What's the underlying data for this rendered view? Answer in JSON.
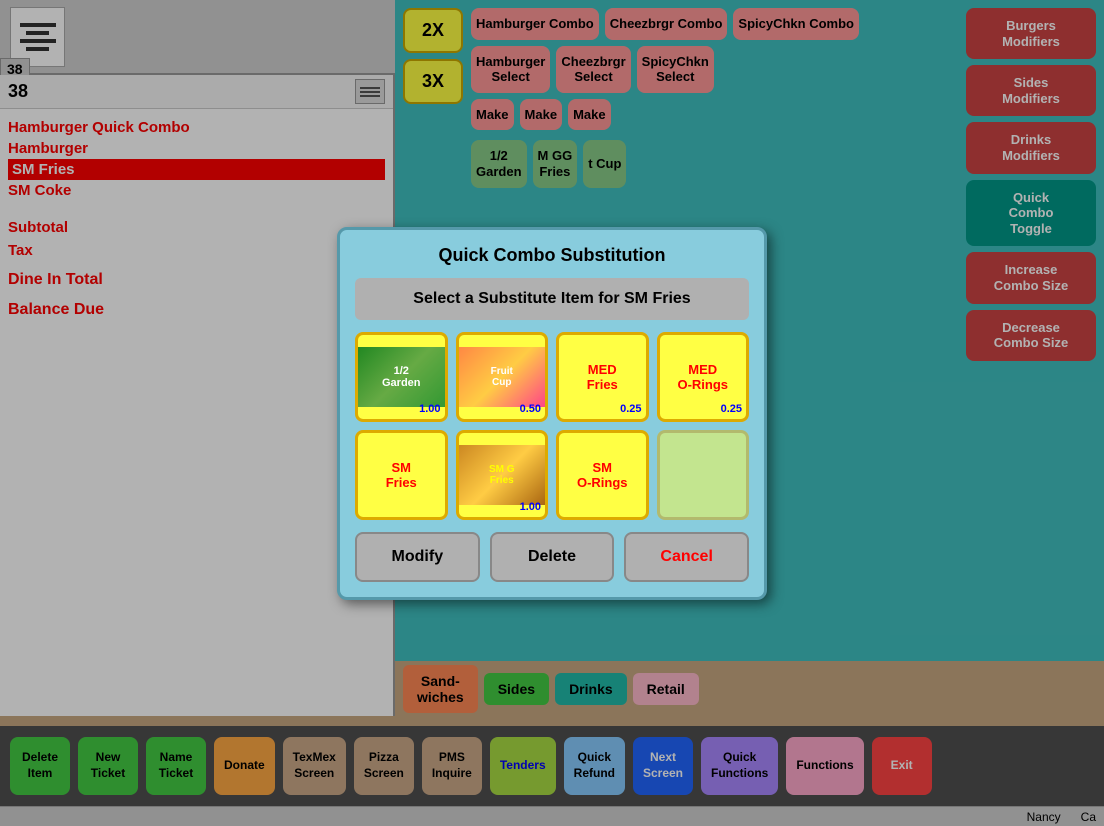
{
  "topBar": {
    "ticketNumber": "38"
  },
  "orderArea": {
    "ticketLabel": "38",
    "items": [
      {
        "text": "Hamburger Quick Combo",
        "selected": false
      },
      {
        "text": "Hamburger",
        "selected": false
      },
      {
        "text": "SM Fries",
        "selected": true
      },
      {
        "text": "SM Coke",
        "selected": false
      }
    ],
    "subtotalLabel": "Subtotal",
    "taxLabel": "Tax",
    "dineInLabel": "Dine In Total",
    "balanceLabel": "Balance Due"
  },
  "menuButtons": {
    "row1": [
      {
        "label": "Hamburger\nCombo",
        "color": "pink"
      },
      {
        "label": "Cheezbrgr\nCombo",
        "color": "pink"
      },
      {
        "label": "SpicyChkn\nCombo",
        "color": "pink"
      }
    ],
    "row2": [
      {
        "label": "Hamburger\nSelect",
        "color": "pink"
      },
      {
        "label": "Cheezbrgr\nSelect",
        "color": "pink"
      },
      {
        "label": "SpicyChkn\nSelect",
        "color": "pink"
      }
    ],
    "row3": [
      {
        "label": "Make\n...",
        "color": "pink"
      },
      {
        "label": "Make\n...",
        "color": "pink"
      },
      {
        "label": "Make\n...",
        "color": "pink"
      }
    ],
    "multipliers": [
      "2X",
      "3X"
    ],
    "modifiers": [
      {
        "label": "Burgers\nModifiers",
        "color": "mod"
      },
      {
        "label": "Sides\nModifiers",
        "color": "mod"
      },
      {
        "label": "Drinks\nModifiers",
        "color": "mod"
      },
      {
        "label": "Quick\nCombo\nToggle",
        "color": "mod"
      }
    ],
    "rightSide": [
      {
        "label": "Increase\nCombo Size",
        "color": "mod"
      },
      {
        "label": "Decrease\nCombo Size",
        "color": "mod"
      }
    ],
    "midItems": [
      {
        "label": "1/2\nGarden",
        "color": "green-item"
      },
      {
        "label": "M GG\nFries",
        "color": "green-item"
      },
      {
        "label": "t Cup",
        "color": "green-item"
      }
    ]
  },
  "categoryBar": {
    "items": [
      {
        "label": "Sand-\nwiches",
        "color": "salmon-dark"
      },
      {
        "label": "Sides",
        "color": "green"
      },
      {
        "label": "Drinks",
        "color": "teal"
      },
      {
        "label": "Retail",
        "color": "pink-light"
      }
    ]
  },
  "actionBar": {
    "buttons": [
      {
        "label": "Delete\nItem",
        "color": "green"
      },
      {
        "label": "New\nTicket",
        "color": "green"
      },
      {
        "label": "Name\nTicket",
        "color": "green"
      },
      {
        "label": "Donate",
        "color": "orange"
      },
      {
        "label": "TexMex\nScreen",
        "color": "tan"
      },
      {
        "label": "Pizza\nScreen",
        "color": "tan"
      },
      {
        "label": "PMS\nInquire",
        "color": "tan"
      },
      {
        "label": "Tenders",
        "color": "yellow-green"
      },
      {
        "label": "Quick\nRefund",
        "color": "light-blue"
      },
      {
        "label": "Next\nScreen",
        "color": "blue"
      },
      {
        "label": "Quick\nFunctions",
        "color": "purple"
      },
      {
        "label": "Functions",
        "color": "pink"
      },
      {
        "label": "Exit",
        "color": "red"
      }
    ]
  },
  "statusBar": {
    "user": "Nancy",
    "extra": "Ca"
  },
  "modal": {
    "title": "Quick Combo Substitution",
    "subtitle": "Select a Substitute Item for SM Fries",
    "items": [
      {
        "label": "1/2\nGarden",
        "price": "1.00",
        "hasImage": true,
        "imageType": "garden"
      },
      {
        "label": "Fruit\nCup",
        "price": "0.50",
        "hasImage": true,
        "imageType": "fruit"
      },
      {
        "label": "MED\nFries",
        "price": "0.25",
        "hasImage": false
      },
      {
        "label": "MED\nO-Rings",
        "price": "0.25",
        "hasImage": false
      },
      {
        "label": "SM\nFries",
        "price": "",
        "hasImage": false
      },
      {
        "label": "SM\nG Fries",
        "price": "1.00",
        "hasImage": true,
        "imageType": "fries"
      },
      {
        "label": "SM\nO-Rings",
        "price": "",
        "hasImage": false
      },
      {
        "label": "",
        "price": "",
        "hasImage": false,
        "empty": true
      }
    ],
    "buttons": [
      {
        "label": "Modify",
        "color": "normal"
      },
      {
        "label": "Delete",
        "color": "normal"
      },
      {
        "label": "Cancel",
        "color": "cancel"
      }
    ]
  }
}
